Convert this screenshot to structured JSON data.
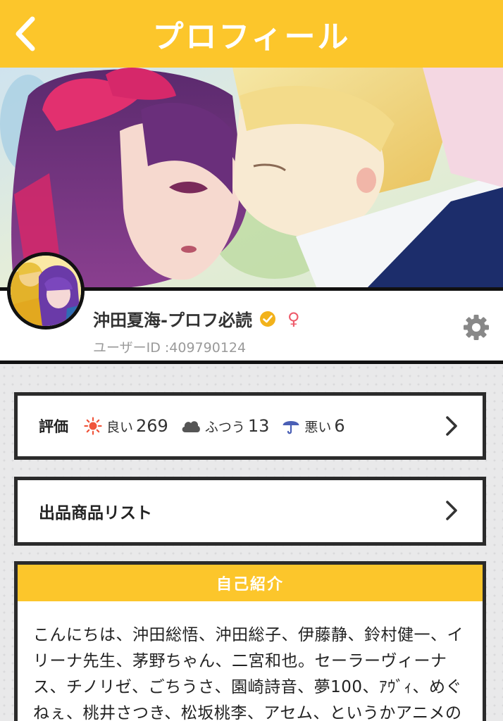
{
  "header": {
    "title": "プロフィール"
  },
  "profile": {
    "name": "沖田夏海-プロフ必読",
    "gender_symbol": "♀",
    "user_id": "ユーザーID :409790124"
  },
  "rating": {
    "label": "評価",
    "good": {
      "label": "良い",
      "count": "269"
    },
    "normal": {
      "label": "ふつう",
      "count": "13"
    },
    "bad": {
      "label": "悪い",
      "count": "6"
    }
  },
  "listing": {
    "label": "出品商品リスト"
  },
  "intro": {
    "title": "自己紹介",
    "text": "こんにちは、沖田総悟、沖田総子、伊藤静、鈴村健一、イリーナ先生、茅野ちゃん、二宮和也。セーラーヴィーナス、チノリゼ、ごちうさ、園崎詩音、夢100、ｱｳﾞｨ、めぐねぇ、桃井さつき、松坂桃李、アセム、というかアニメの女の子は気に入った子は皆"
  },
  "colors": {
    "accent": "#fcc62b",
    "border": "#2b2b2b",
    "verified": "#f2b21b",
    "female": "#ee5a6a",
    "sun": "#f0553b",
    "cloud": "#555555",
    "umbrella": "#4a5fb5"
  },
  "icons": {
    "back": "chevron-left-icon",
    "verified": "verified-badge-icon",
    "settings": "gear-icon",
    "good": "sun-icon",
    "normal": "cloud-icon",
    "bad": "umbrella-icon"
  }
}
